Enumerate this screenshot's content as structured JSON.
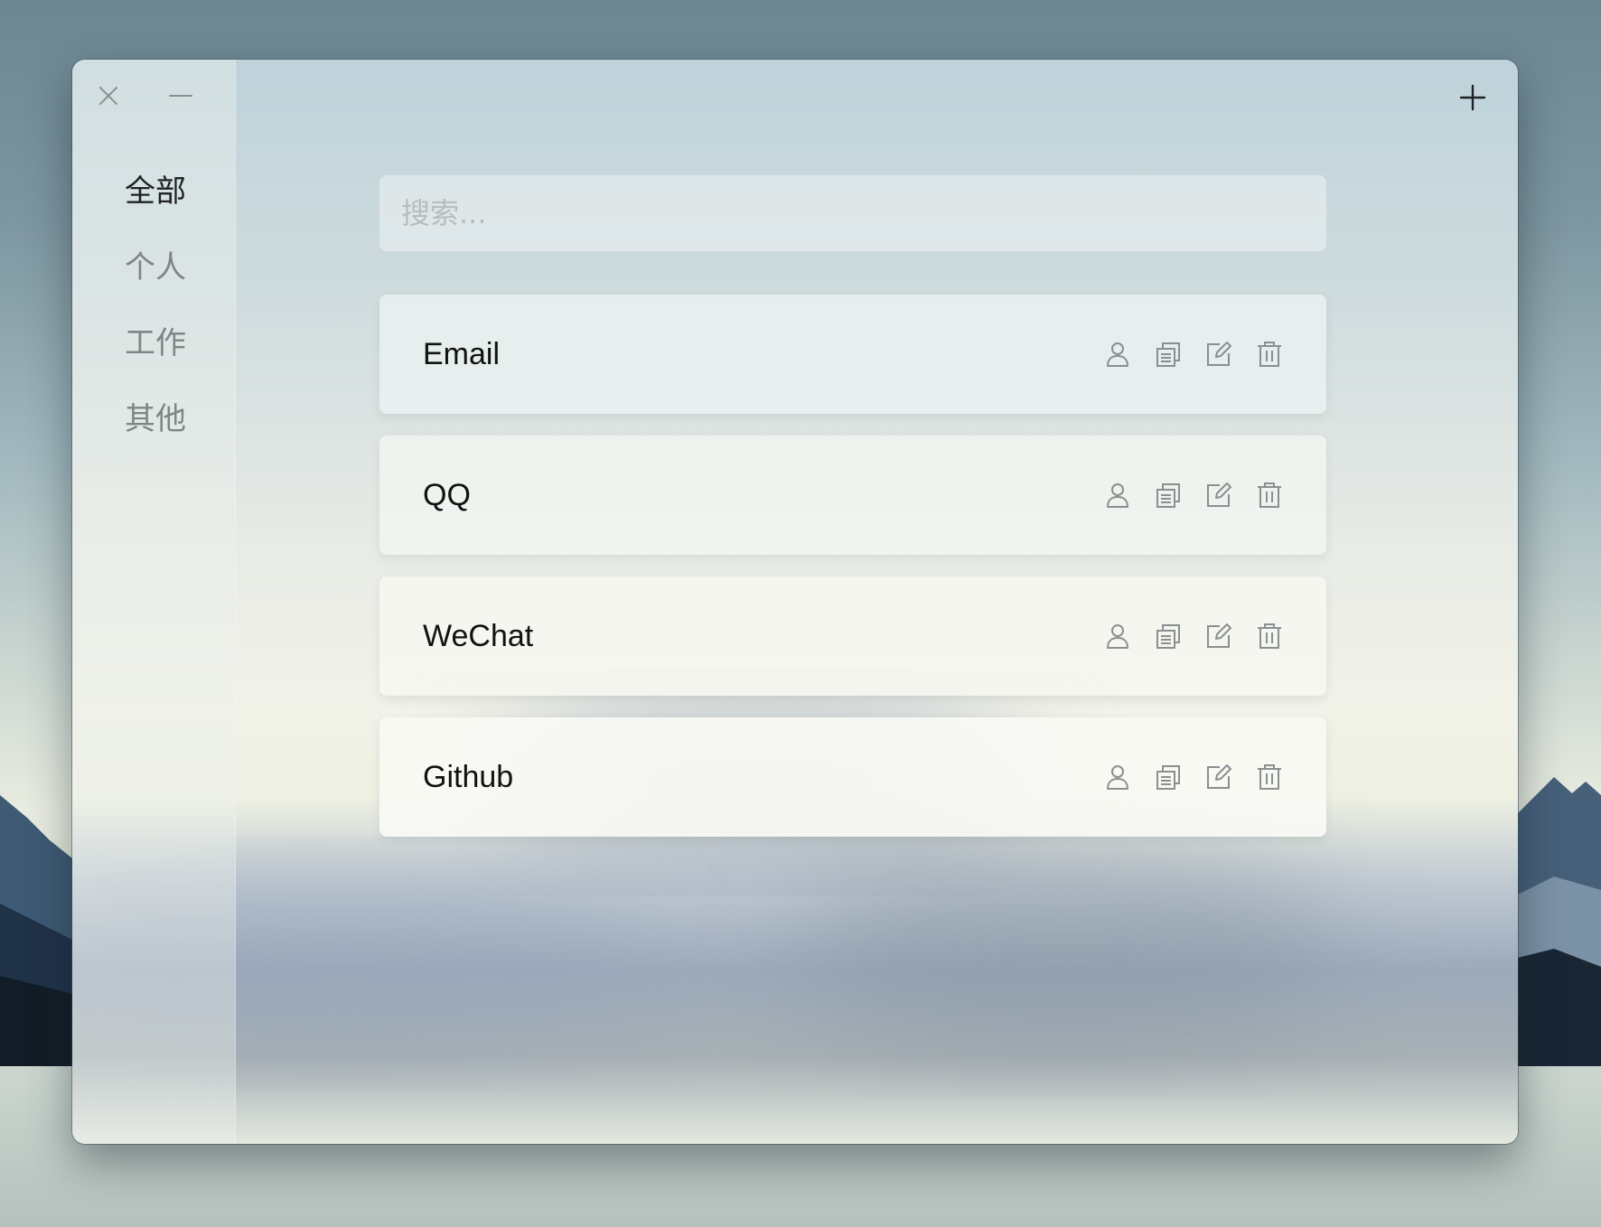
{
  "window": {
    "controls": {
      "close_icon": "close-icon",
      "minimize_icon": "minimize-icon",
      "add_icon": "plus-icon"
    }
  },
  "sidebar": {
    "items": [
      {
        "label": "全部",
        "active": true
      },
      {
        "label": "个人",
        "active": false
      },
      {
        "label": "工作",
        "active": false
      },
      {
        "label": "其他",
        "active": false
      }
    ]
  },
  "search": {
    "placeholder": "搜索...",
    "value": ""
  },
  "accounts": [
    {
      "name": "Email"
    },
    {
      "name": "QQ"
    },
    {
      "name": "WeChat"
    },
    {
      "name": "Github"
    }
  ],
  "row_actions": [
    "user-icon",
    "copy-icon",
    "edit-icon",
    "trash-icon"
  ],
  "colors": {
    "text_primary": "#111111",
    "text_muted": "#7f8587",
    "icon": "#8a8f91"
  }
}
